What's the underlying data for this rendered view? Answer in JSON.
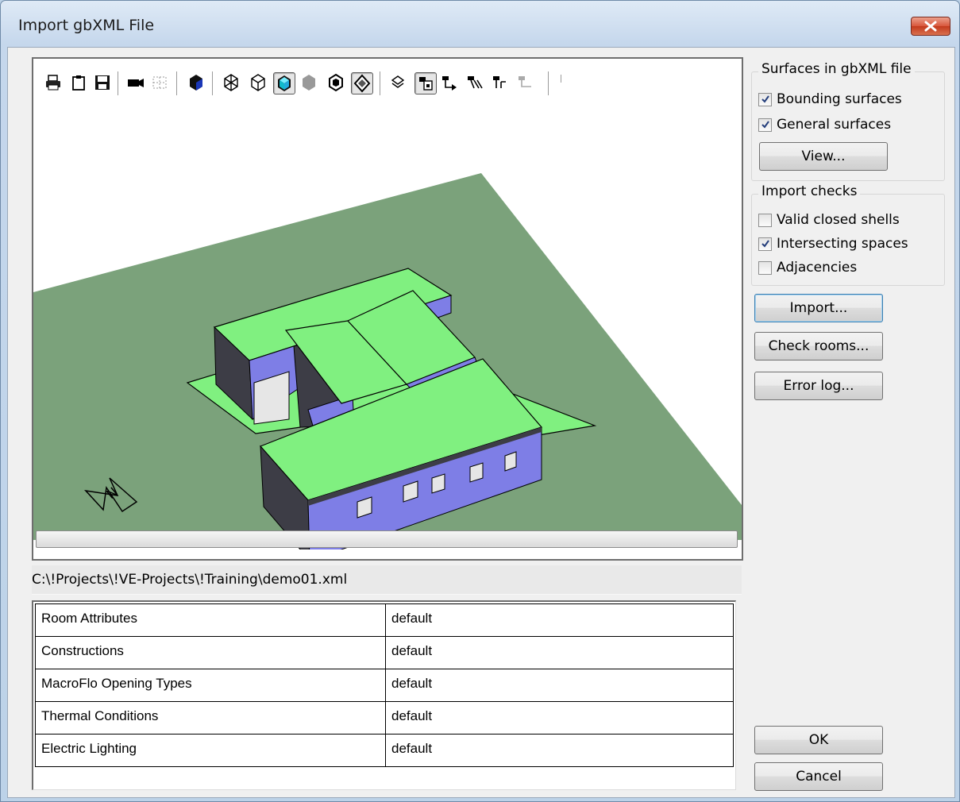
{
  "window": {
    "title": "Import gbXML File"
  },
  "toolbar": {
    "icons": [
      "printer-icon",
      "clipboard-icon",
      "save-icon",
      "camera-icon",
      "grid-icon",
      "solid-view-icon",
      "wireframe-icon",
      "hidden-line-icon",
      "shaded-icon",
      "surface-icon",
      "transparent-icon",
      "highlight-icon",
      "layers-icon",
      "select-all-icon",
      "select-next-icon",
      "select-prev-icon",
      "select-group-icon",
      "deselect-icon"
    ]
  },
  "viewer": {
    "north_label": "N"
  },
  "file": {
    "path": "C:\\!Projects\\!VE-Projects\\!Training\\demo01.xml"
  },
  "attributes": {
    "rows": [
      {
        "label": "Room Attributes",
        "value": "default"
      },
      {
        "label": "Constructions",
        "value": "default"
      },
      {
        "label": "MacroFlo Opening Types",
        "value": "default"
      },
      {
        "label": "Thermal Conditions",
        "value": "default"
      },
      {
        "label": "Electric Lighting",
        "value": "default"
      }
    ]
  },
  "surfaces": {
    "legend": "Surfaces in gbXML file",
    "bounding": {
      "label": "Bounding surfaces",
      "checked": true
    },
    "general": {
      "label": "General surfaces",
      "checked": true
    },
    "view_label": "View..."
  },
  "checks": {
    "legend": "Import checks",
    "closed_shells": {
      "label": "Valid closed shells",
      "checked": false
    },
    "intersecting": {
      "label": "Intersecting spaces",
      "checked": true
    },
    "adjacencies": {
      "label": "Adjacencies",
      "checked": false
    }
  },
  "buttons": {
    "import": "Import...",
    "check_rooms": "Check rooms...",
    "error_log": "Error log...",
    "ok": "OK",
    "cancel": "Cancel"
  },
  "colors": {
    "ground": "#7ba27b",
    "roof": "#80f080",
    "walls": "#7e7ee6",
    "close_button": "#d3563b"
  }
}
